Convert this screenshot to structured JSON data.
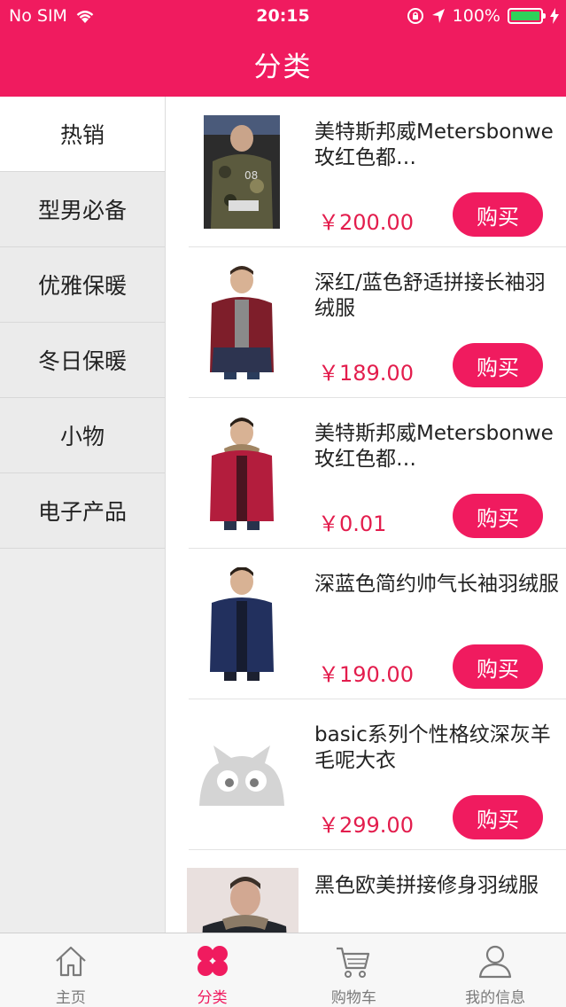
{
  "status_bar": {
    "carrier": "No SIM",
    "time": "20:15",
    "battery": "100%"
  },
  "header": {
    "title": "分类"
  },
  "sidebar": {
    "items": [
      {
        "label": "热销",
        "active": true
      },
      {
        "label": "型男必备",
        "active": false
      },
      {
        "label": "优雅保暖",
        "active": false
      },
      {
        "label": "冬日保暖",
        "active": false
      },
      {
        "label": "小物",
        "active": false
      },
      {
        "label": "电子产品",
        "active": false
      }
    ]
  },
  "products": [
    {
      "name": "美特斯邦威Metersbonwe玫红色都…",
      "price": "￥200.00",
      "buy_label": "购买",
      "image": "camo-jacket"
    },
    {
      "name": "深红/蓝色舒适拼接长袖羽绒服",
      "price": "￥189.00",
      "buy_label": "购买",
      "image": "red-blue-down-jacket"
    },
    {
      "name": "美特斯邦威Metersbonwe玫红色都…",
      "price": "￥0.01",
      "buy_label": "购买",
      "image": "rose-red-down-jacket"
    },
    {
      "name": "深蓝色简约帅气长袖羽绒服",
      "price": "￥190.00",
      "buy_label": "购买",
      "image": "navy-down-jacket"
    },
    {
      "name": "basic系列个性格纹深灰羊毛呢大衣",
      "price": "￥299.00",
      "buy_label": "购买",
      "image": "placeholder-owl"
    },
    {
      "name": "黑色欧美拼接修身羽绒服",
      "price": "",
      "buy_label": "",
      "image": "black-jacket"
    }
  ],
  "tabbar": {
    "items": [
      {
        "label": "主页",
        "icon": "home-icon",
        "active": false
      },
      {
        "label": "分类",
        "icon": "category-icon",
        "active": true
      },
      {
        "label": "购物车",
        "icon": "cart-icon",
        "active": false
      },
      {
        "label": "我的信息",
        "icon": "profile-icon",
        "active": false
      }
    ]
  },
  "colors": {
    "brand": "#f01b5f",
    "price": "#e31d4d",
    "sidebar_bg": "#ebebeb"
  }
}
